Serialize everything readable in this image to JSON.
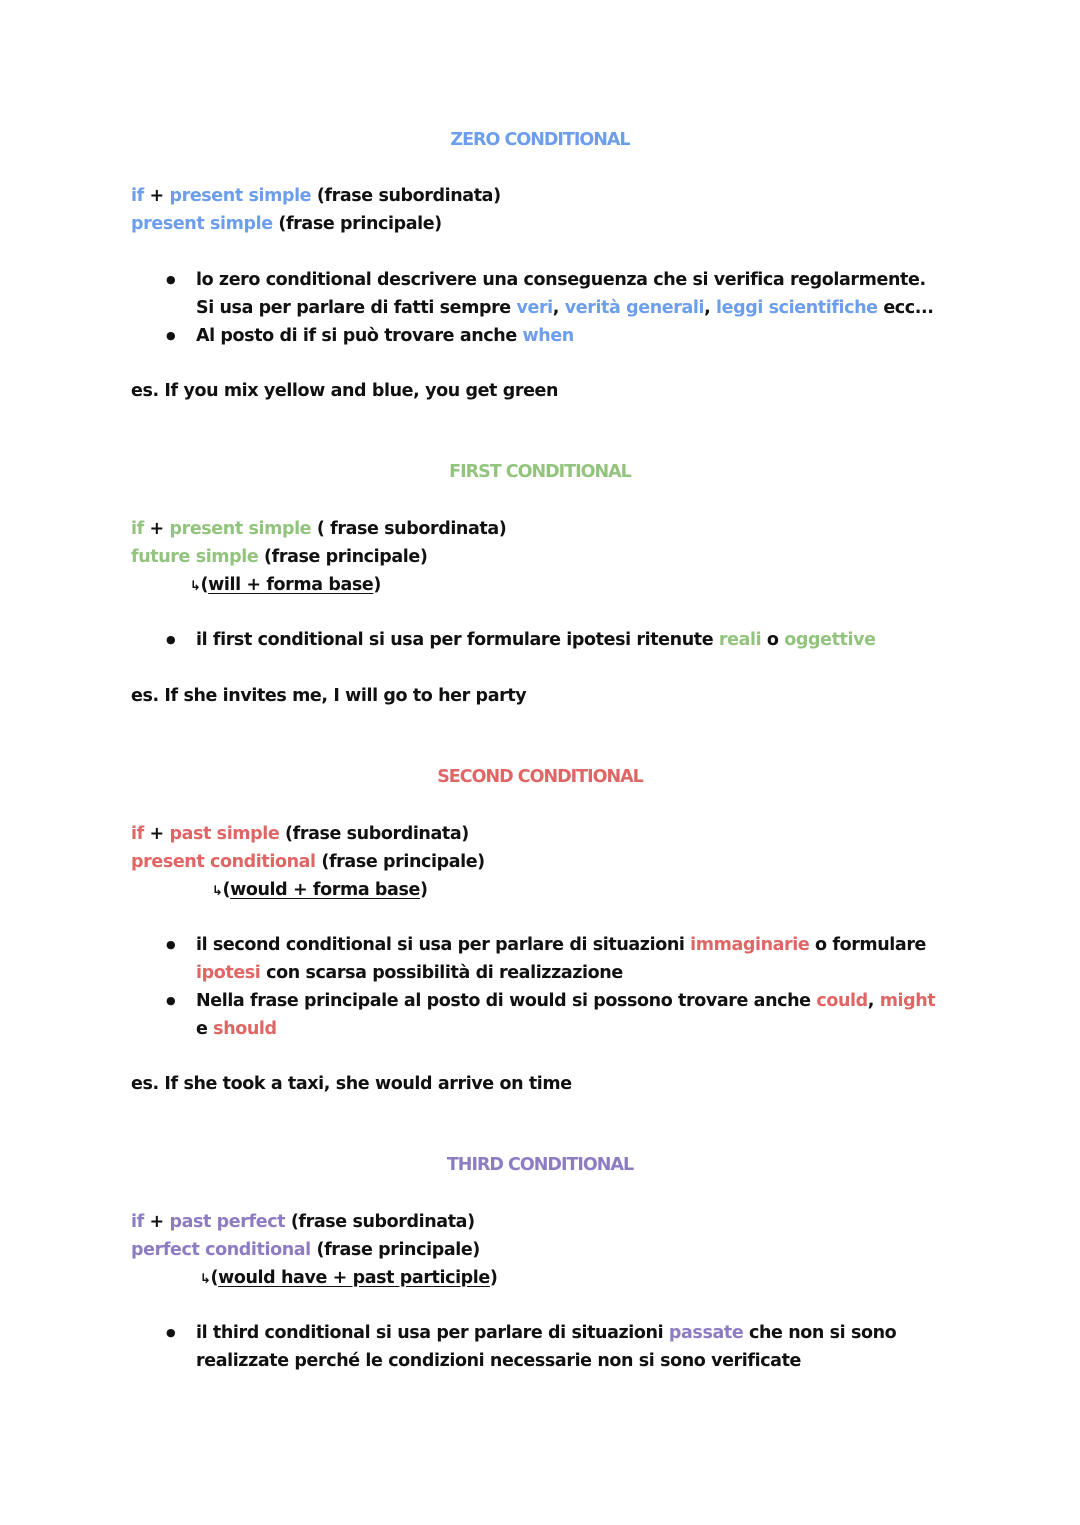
{
  "colors": {
    "zero": "#6d9eeb",
    "first": "#93c47d",
    "second": "#e06666",
    "third": "#8e7cc3",
    "text": "#111111"
  },
  "zero": {
    "title": "ZERO CONDITIONAL",
    "line1": {
      "if": "if",
      "plus": " + ",
      "tense": "present simple",
      "note": " (frase subordinata)"
    },
    "line2": {
      "tense": "present simple",
      "note": " (frase principale)"
    },
    "bullets": [
      {
        "lines": [
          {
            "parts": [
              {
                "t": "lo zero conditional descrivere una conseguenza che si verifica regolarmente."
              }
            ]
          },
          {
            "parts": [
              {
                "t": "Si usa per parlare di fatti sempre "
              },
              {
                "t": "veri",
                "c": 1
              },
              {
                "t": ", "
              },
              {
                "t": "verità generali",
                "c": 1
              },
              {
                "t": ", "
              },
              {
                "t": "leggi scientifiche",
                "c": 1
              },
              {
                "t": " ecc..."
              }
            ]
          }
        ]
      },
      {
        "lines": [
          {
            "parts": [
              {
                "t": "Al posto di if si può trovare anche "
              },
              {
                "t": "when",
                "c": 1
              }
            ]
          }
        ]
      }
    ],
    "example": "es. If you mix yellow and blue, you get green"
  },
  "first": {
    "title": "FIRST CONDITIONAL",
    "line1": {
      "if": "if",
      "plus": " + ",
      "tense": "present simple",
      "note": " ( frase subordinata)"
    },
    "line2": {
      "tense": "future simple",
      "note": " (frase principale)"
    },
    "arrow": "↳",
    "formula_open": "(",
    "formula": "will + forma base",
    "formula_close": ")",
    "bullets": [
      {
        "lines": [
          {
            "parts": [
              {
                "t": "il first conditional si usa per formulare ipotesi ritenute "
              },
              {
                "t": "reali",
                "c": 1
              },
              {
                "t": " o "
              },
              {
                "t": "oggettive",
                "c": 1
              }
            ]
          }
        ]
      }
    ],
    "example": "es. If she invites me, I will go to her party"
  },
  "second": {
    "title": "SECOND CONDITIONAL",
    "line1": {
      "if": "if",
      "plus": " + ",
      "tense": "past simple",
      "note": " (frase subordinata)"
    },
    "line2": {
      "tense": "present conditional",
      "note": " (frase principale)"
    },
    "arrow": "↳",
    "formula_open": "(",
    "formula": "would + forma base",
    "formula_close": ")",
    "bullets": [
      {
        "lines": [
          {
            "parts": [
              {
                "t": "il second conditional si usa per parlare di situazioni "
              },
              {
                "t": "immaginarie",
                "c": 1
              },
              {
                "t": " o formulare"
              }
            ]
          },
          {
            "parts": [
              {
                "t": "ipotesi",
                "c": 1
              },
              {
                "t": " con scarsa possibilità di realizzazione"
              }
            ]
          }
        ]
      },
      {
        "lines": [
          {
            "parts": [
              {
                "t": "Nella frase principale al posto di would si possono trovare anche "
              },
              {
                "t": "could",
                "c": 1
              },
              {
                "t": ", "
              },
              {
                "t": "might",
                "c": 1
              }
            ]
          },
          {
            "parts": [
              {
                "t": "e "
              },
              {
                "t": "should",
                "c": 1
              }
            ]
          }
        ]
      }
    ],
    "example": "es. If she took a taxi, she would arrive on time"
  },
  "third": {
    "title": "THIRD CONDITIONAL",
    "line1": {
      "if": "if",
      "plus": " + ",
      "tense": "past perfect",
      "note": " (frase subordinata)"
    },
    "line2": {
      "tense": "perfect conditional",
      "note": " (frase principale)"
    },
    "arrow": "↳",
    "formula_open": "(",
    "formula": "would have + past participle",
    "formula_close": ")",
    "bullets": [
      {
        "lines": [
          {
            "parts": [
              {
                "t": "il third conditional si usa per parlare di situazioni "
              },
              {
                "t": "passate",
                "c": 1
              },
              {
                "t": " che non si sono"
              }
            ]
          },
          {
            "parts": [
              {
                "t": "realizzate perché le condizioni necessarie non si sono verificate"
              }
            ]
          }
        ]
      }
    ]
  }
}
